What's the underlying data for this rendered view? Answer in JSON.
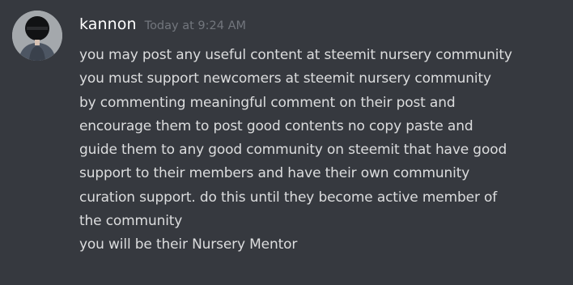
{
  "message": {
    "author": "kannon",
    "timestamp": "Today at 9:24 AM",
    "avatar_icon": "user-avatar-image",
    "lines": [
      "you may post any useful content at steemit nursery community",
      "you must support newcomers at steemit nursery community",
      "by commenting meaningful comment on their post and",
      "encourage them to post good contents no copy paste and",
      "guide them to any good community on steemit that have good",
      "support to their members and have their own community",
      "curation support. do this until they become active member of",
      "the community",
      "you will be their Nursery Mentor"
    ]
  },
  "colors": {
    "background": "#36393f",
    "username": "#ffffff",
    "timestamp": "#72767d",
    "text": "#dcddde"
  }
}
